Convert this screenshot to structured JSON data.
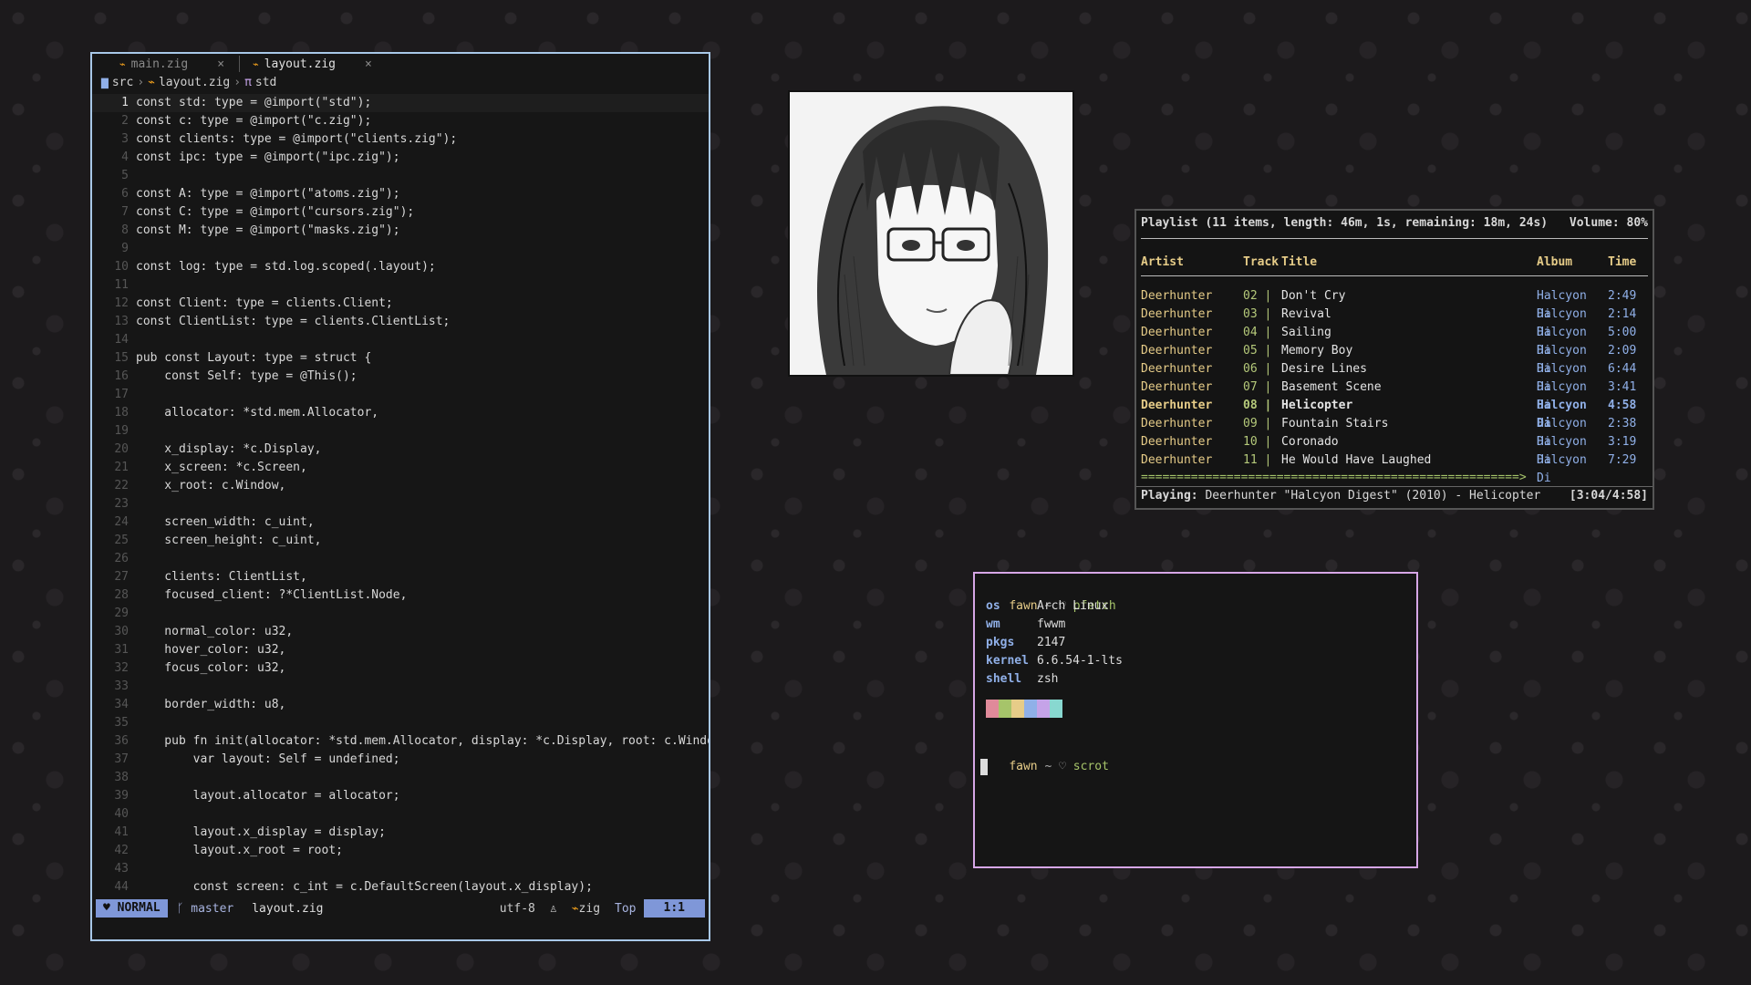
{
  "editor": {
    "tabs": [
      {
        "icon": "zig-icon",
        "label": "main.zig",
        "active": false
      },
      {
        "icon": "zig-icon",
        "label": "layout.zig",
        "active": true
      }
    ],
    "breadcrumb": {
      "folder": "src",
      "file": "layout.zig",
      "symbol": "std"
    },
    "lines": [
      {
        "n": "1",
        "text": "const std: type = @import(\"std\");"
      },
      {
        "n": "2",
        "text": "const c: type = @import(\"c.zig\");"
      },
      {
        "n": "3",
        "text": "const clients: type = @import(\"clients.zig\");"
      },
      {
        "n": "4",
        "text": "const ipc: type = @import(\"ipc.zig\");"
      },
      {
        "n": "5",
        "text": ""
      },
      {
        "n": "6",
        "text": "const A: type = @import(\"atoms.zig\");"
      },
      {
        "n": "7",
        "text": "const C: type = @import(\"cursors.zig\");"
      },
      {
        "n": "8",
        "text": "const M: type = @import(\"masks.zig\");"
      },
      {
        "n": "9",
        "text": ""
      },
      {
        "n": "10",
        "text": "const log: type = std.log.scoped(.layout);"
      },
      {
        "n": "11",
        "text": ""
      },
      {
        "n": "12",
        "text": "const Client: type = clients.Client;"
      },
      {
        "n": "13",
        "text": "const ClientList: type = clients.ClientList;"
      },
      {
        "n": "14",
        "text": ""
      },
      {
        "n": "15",
        "text": "pub const Layout: type = struct {"
      },
      {
        "n": "16",
        "text": "    const Self: type = @This();"
      },
      {
        "n": "17",
        "text": ""
      },
      {
        "n": "18",
        "text": "    allocator: *std.mem.Allocator,"
      },
      {
        "n": "19",
        "text": ""
      },
      {
        "n": "20",
        "text": "    x_display: *c.Display,"
      },
      {
        "n": "21",
        "text": "    x_screen: *c.Screen,"
      },
      {
        "n": "22",
        "text": "    x_root: c.Window,"
      },
      {
        "n": "23",
        "text": ""
      },
      {
        "n": "24",
        "text": "    screen_width: c_uint,"
      },
      {
        "n": "25",
        "text": "    screen_height: c_uint,"
      },
      {
        "n": "26",
        "text": ""
      },
      {
        "n": "27",
        "text": "    clients: ClientList,"
      },
      {
        "n": "28",
        "text": "    focused_client: ?*ClientList.Node,"
      },
      {
        "n": "29",
        "text": ""
      },
      {
        "n": "30",
        "text": "    normal_color: u32,"
      },
      {
        "n": "31",
        "text": "    hover_color: u32,"
      },
      {
        "n": "32",
        "text": "    focus_color: u32,"
      },
      {
        "n": "33",
        "text": ""
      },
      {
        "n": "34",
        "text": "    border_width: u8,"
      },
      {
        "n": "35",
        "text": ""
      },
      {
        "n": "36",
        "text": "    pub fn init(allocator: *std.mem.Allocator, display: *c.Display, root: c.Window) !Self"
      },
      {
        "n": "37",
        "text": "        var layout: Self = undefined;"
      },
      {
        "n": "38",
        "text": ""
      },
      {
        "n": "39",
        "text": "        layout.allocator = allocator;"
      },
      {
        "n": "40",
        "text": ""
      },
      {
        "n": "41",
        "text": "        layout.x_display = display;"
      },
      {
        "n": "42",
        "text": "        layout.x_root = root;"
      },
      {
        "n": "43",
        "text": ""
      },
      {
        "n": "44",
        "text": "        const screen: c_int = c.DefaultScreen(layout.x_display);"
      }
    ],
    "status": {
      "mode": "NORMAL",
      "branch": "master",
      "file": "layout.zig",
      "encoding": "utf-8",
      "filetype": "zig",
      "scroll": "Top",
      "position": "1:1"
    }
  },
  "player": {
    "header": "Playlist (11 items, length: 46m, 1s, remaining: 18m, 24s)",
    "volume": "Volume: 80%",
    "columns": {
      "artist": "Artist",
      "track": "Track",
      "title": "Title",
      "album": "Album",
      "time": "Time"
    },
    "rows": [
      {
        "artist": "Deerhunter",
        "track": "02",
        "title": "Don't Cry",
        "album": "Halcyon Di",
        "time": "2:49",
        "playing": false
      },
      {
        "artist": "Deerhunter",
        "track": "03",
        "title": "Revival",
        "album": "Halcyon Di",
        "time": "2:14",
        "playing": false
      },
      {
        "artist": "Deerhunter",
        "track": "04",
        "title": "Sailing",
        "album": "Halcyon Di",
        "time": "5:00",
        "playing": false
      },
      {
        "artist": "Deerhunter",
        "track": "05",
        "title": "Memory Boy",
        "album": "Halcyon Di",
        "time": "2:09",
        "playing": false
      },
      {
        "artist": "Deerhunter",
        "track": "06",
        "title": "Desire Lines",
        "album": "Halcyon Di",
        "time": "6:44",
        "playing": false
      },
      {
        "artist": "Deerhunter",
        "track": "07",
        "title": "Basement Scene",
        "album": "Halcyon Di",
        "time": "3:41",
        "playing": false
      },
      {
        "artist": "Deerhunter",
        "track": "08",
        "title": "Helicopter",
        "album": "Halcyon Di",
        "time": "4:58",
        "playing": true
      },
      {
        "artist": "Deerhunter",
        "track": "09",
        "title": "Fountain Stairs",
        "album": "Halcyon Di",
        "time": "2:38",
        "playing": false
      },
      {
        "artist": "Deerhunter",
        "track": "10",
        "title": "Coronado",
        "album": "Halcyon Di",
        "time": "3:19",
        "playing": false
      },
      {
        "artist": "Deerhunter",
        "track": "11",
        "title": "He Would Have Laughed",
        "album": "Halcyon Di",
        "time": "7:29",
        "playing": false
      }
    ],
    "progress_bar": "=====================================================>",
    "progress_fraction": 0.62,
    "playing_label": "Playing:",
    "now_playing": "Deerhunter \"Halcyon Digest\" (2010) - Helicopter",
    "elapsed": "[3:04/4:58]"
  },
  "terminal": {
    "prompt_user": "fawn",
    "prompt_tilde": "~",
    "prompt_symbol": "♡",
    "cmd1": "pfetch",
    "fetch": [
      {
        "k": "os",
        "v": "Arch Linux"
      },
      {
        "k": "wm",
        "v": "fwwm"
      },
      {
        "k": "pkgs",
        "v": "2147"
      },
      {
        "k": "kernel",
        "v": "6.6.54-1-lts"
      },
      {
        "k": "shell",
        "v": "zsh"
      }
    ],
    "swatch_colors": [
      "#e08a9a",
      "#a6c46a",
      "#e6cc88",
      "#90b0e8",
      "#c5a3e8",
      "#88d8d0"
    ],
    "cmd2": "scrot"
  },
  "colors": {
    "accent_blue": "#7f97d8",
    "editor_border": "#a8c8e8",
    "terminal_border": "#d6a6e6"
  }
}
